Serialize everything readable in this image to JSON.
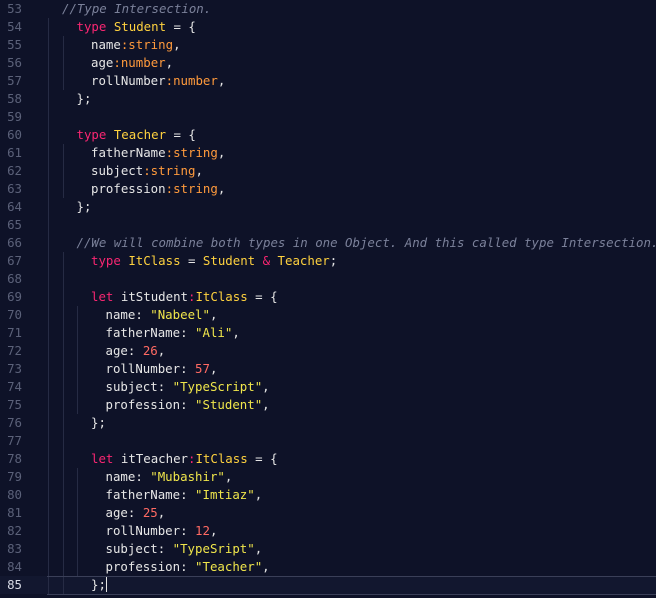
{
  "editor": {
    "current_line": 85,
    "lines": [
      {
        "no": "53",
        "indent": 0,
        "tokens": [
          {
            "c": "comment",
            "t": "//Type Intersection."
          }
        ]
      },
      {
        "no": "54",
        "indent": 1,
        "tokens": [
          {
            "c": "keyword",
            "t": "type"
          },
          {
            "c": "punct",
            "t": " "
          },
          {
            "c": "type",
            "t": "Student"
          },
          {
            "c": "punct",
            "t": " = {"
          }
        ]
      },
      {
        "no": "55",
        "indent": 2,
        "tokens": [
          {
            "c": "prop",
            "t": "name"
          },
          {
            "c": "ptype",
            "t": ":string"
          },
          {
            "c": "punct",
            "t": ","
          }
        ]
      },
      {
        "no": "56",
        "indent": 2,
        "tokens": [
          {
            "c": "prop",
            "t": "age"
          },
          {
            "c": "ptype",
            "t": ":number"
          },
          {
            "c": "punct",
            "t": ","
          }
        ]
      },
      {
        "no": "57",
        "indent": 2,
        "tokens": [
          {
            "c": "prop",
            "t": "rollNumber"
          },
          {
            "c": "ptype",
            "t": ":number"
          },
          {
            "c": "punct",
            "t": ","
          }
        ]
      },
      {
        "no": "58",
        "indent": 1,
        "tokens": [
          {
            "c": "punct",
            "t": "};"
          }
        ]
      },
      {
        "no": "59",
        "indent": 0,
        "tokens": []
      },
      {
        "no": "60",
        "indent": 1,
        "tokens": [
          {
            "c": "keyword",
            "t": "type"
          },
          {
            "c": "punct",
            "t": " "
          },
          {
            "c": "type",
            "t": "Teacher"
          },
          {
            "c": "punct",
            "t": " = {"
          }
        ]
      },
      {
        "no": "61",
        "indent": 2,
        "tokens": [
          {
            "c": "prop",
            "t": "fatherName"
          },
          {
            "c": "ptype",
            "t": ":string"
          },
          {
            "c": "punct",
            "t": ","
          }
        ]
      },
      {
        "no": "62",
        "indent": 2,
        "tokens": [
          {
            "c": "prop",
            "t": "subject"
          },
          {
            "c": "ptype",
            "t": ":string"
          },
          {
            "c": "punct",
            "t": ","
          }
        ]
      },
      {
        "no": "63",
        "indent": 2,
        "tokens": [
          {
            "c": "prop",
            "t": "profession"
          },
          {
            "c": "ptype",
            "t": ":string"
          },
          {
            "c": "punct",
            "t": ","
          }
        ]
      },
      {
        "no": "64",
        "indent": 1,
        "tokens": [
          {
            "c": "punct",
            "t": "};"
          }
        ]
      },
      {
        "no": "65",
        "indent": 0,
        "tokens": []
      },
      {
        "no": "66",
        "indent": 1,
        "tokens": [
          {
            "c": "comment",
            "t": "//We will combine both types in one Object. And this called type Intersection."
          }
        ]
      },
      {
        "no": "67",
        "indent": 2,
        "tokens": [
          {
            "c": "keyword",
            "t": "type"
          },
          {
            "c": "punct",
            "t": " "
          },
          {
            "c": "type",
            "t": "ItClass"
          },
          {
            "c": "punct",
            "t": " = "
          },
          {
            "c": "type",
            "t": "Student"
          },
          {
            "c": "punct",
            "t": " "
          },
          {
            "c": "op",
            "t": "&"
          },
          {
            "c": "punct",
            "t": " "
          },
          {
            "c": "type",
            "t": "Teacher"
          },
          {
            "c": "punct",
            "t": ";"
          }
        ]
      },
      {
        "no": "68",
        "indent": 0,
        "tokens": []
      },
      {
        "no": "69",
        "indent": 2,
        "tokens": [
          {
            "c": "keyword",
            "t": "let"
          },
          {
            "c": "punct",
            "t": " "
          },
          {
            "c": "ident",
            "t": "itStudent"
          },
          {
            "c": "op",
            "t": ":"
          },
          {
            "c": "type",
            "t": "ItClass"
          },
          {
            "c": "punct",
            "t": " = {"
          }
        ]
      },
      {
        "no": "70",
        "indent": 3,
        "tokens": [
          {
            "c": "prop",
            "t": "name"
          },
          {
            "c": "punct",
            "t": ": "
          },
          {
            "c": "string",
            "t": "\"Nabeel\""
          },
          {
            "c": "punct",
            "t": ","
          }
        ]
      },
      {
        "no": "71",
        "indent": 3,
        "tokens": [
          {
            "c": "prop",
            "t": "fatherName"
          },
          {
            "c": "punct",
            "t": ": "
          },
          {
            "c": "string",
            "t": "\"Ali\""
          },
          {
            "c": "punct",
            "t": ","
          }
        ]
      },
      {
        "no": "72",
        "indent": 3,
        "tokens": [
          {
            "c": "prop",
            "t": "age"
          },
          {
            "c": "punct",
            "t": ": "
          },
          {
            "c": "number",
            "t": "26"
          },
          {
            "c": "punct",
            "t": ","
          }
        ]
      },
      {
        "no": "73",
        "indent": 3,
        "tokens": [
          {
            "c": "prop",
            "t": "rollNumber"
          },
          {
            "c": "punct",
            "t": ": "
          },
          {
            "c": "number",
            "t": "57"
          },
          {
            "c": "punct",
            "t": ","
          }
        ]
      },
      {
        "no": "74",
        "indent": 3,
        "tokens": [
          {
            "c": "prop",
            "t": "subject"
          },
          {
            "c": "punct",
            "t": ": "
          },
          {
            "c": "string",
            "t": "\"TypeScript\""
          },
          {
            "c": "punct",
            "t": ","
          }
        ]
      },
      {
        "no": "75",
        "indent": 3,
        "tokens": [
          {
            "c": "prop",
            "t": "profession"
          },
          {
            "c": "punct",
            "t": ": "
          },
          {
            "c": "string",
            "t": "\"Student\""
          },
          {
            "c": "punct",
            "t": ","
          }
        ]
      },
      {
        "no": "76",
        "indent": 2,
        "tokens": [
          {
            "c": "punct",
            "t": "};"
          }
        ]
      },
      {
        "no": "77",
        "indent": 0,
        "tokens": []
      },
      {
        "no": "78",
        "indent": 2,
        "tokens": [
          {
            "c": "keyword",
            "t": "let"
          },
          {
            "c": "punct",
            "t": " "
          },
          {
            "c": "ident",
            "t": "itTeacher"
          },
          {
            "c": "op",
            "t": ":"
          },
          {
            "c": "type",
            "t": "ItClass"
          },
          {
            "c": "punct",
            "t": " = {"
          }
        ]
      },
      {
        "no": "79",
        "indent": 3,
        "tokens": [
          {
            "c": "prop",
            "t": "name"
          },
          {
            "c": "punct",
            "t": ": "
          },
          {
            "c": "string",
            "t": "\"Mubashir\""
          },
          {
            "c": "punct",
            "t": ","
          }
        ]
      },
      {
        "no": "80",
        "indent": 3,
        "tokens": [
          {
            "c": "prop",
            "t": "fatherName"
          },
          {
            "c": "punct",
            "t": ": "
          },
          {
            "c": "string",
            "t": "\"Imtiaz\""
          },
          {
            "c": "punct",
            "t": ","
          }
        ]
      },
      {
        "no": "81",
        "indent": 3,
        "tokens": [
          {
            "c": "prop",
            "t": "age"
          },
          {
            "c": "punct",
            "t": ": "
          },
          {
            "c": "number",
            "t": "25"
          },
          {
            "c": "punct",
            "t": ","
          }
        ]
      },
      {
        "no": "82",
        "indent": 3,
        "tokens": [
          {
            "c": "prop",
            "t": "rollNumber"
          },
          {
            "c": "punct",
            "t": ": "
          },
          {
            "c": "number",
            "t": "12"
          },
          {
            "c": "punct",
            "t": ","
          }
        ]
      },
      {
        "no": "83",
        "indent": 3,
        "tokens": [
          {
            "c": "prop",
            "t": "subject"
          },
          {
            "c": "punct",
            "t": ": "
          },
          {
            "c": "string",
            "t": "\"TypeSript\""
          },
          {
            "c": "punct",
            "t": ","
          }
        ]
      },
      {
        "no": "84",
        "indent": 3,
        "tokens": [
          {
            "c": "prop",
            "t": "profession"
          },
          {
            "c": "punct",
            "t": ": "
          },
          {
            "c": "string",
            "t": "\"Teacher\""
          },
          {
            "c": "punct",
            "t": ","
          }
        ]
      },
      {
        "no": "85",
        "indent": 2,
        "tokens": [
          {
            "c": "punct",
            "t": "};"
          }
        ],
        "cursor": true
      }
    ]
  },
  "theme": {
    "background": "#0e1228",
    "keyword": "#f92672",
    "type": "#ffd23f",
    "property_type": "#ff9a3c",
    "string": "#f0e64b",
    "number": "#ff6a63",
    "comment": "#7b819a",
    "line_number": "#5b6179"
  }
}
